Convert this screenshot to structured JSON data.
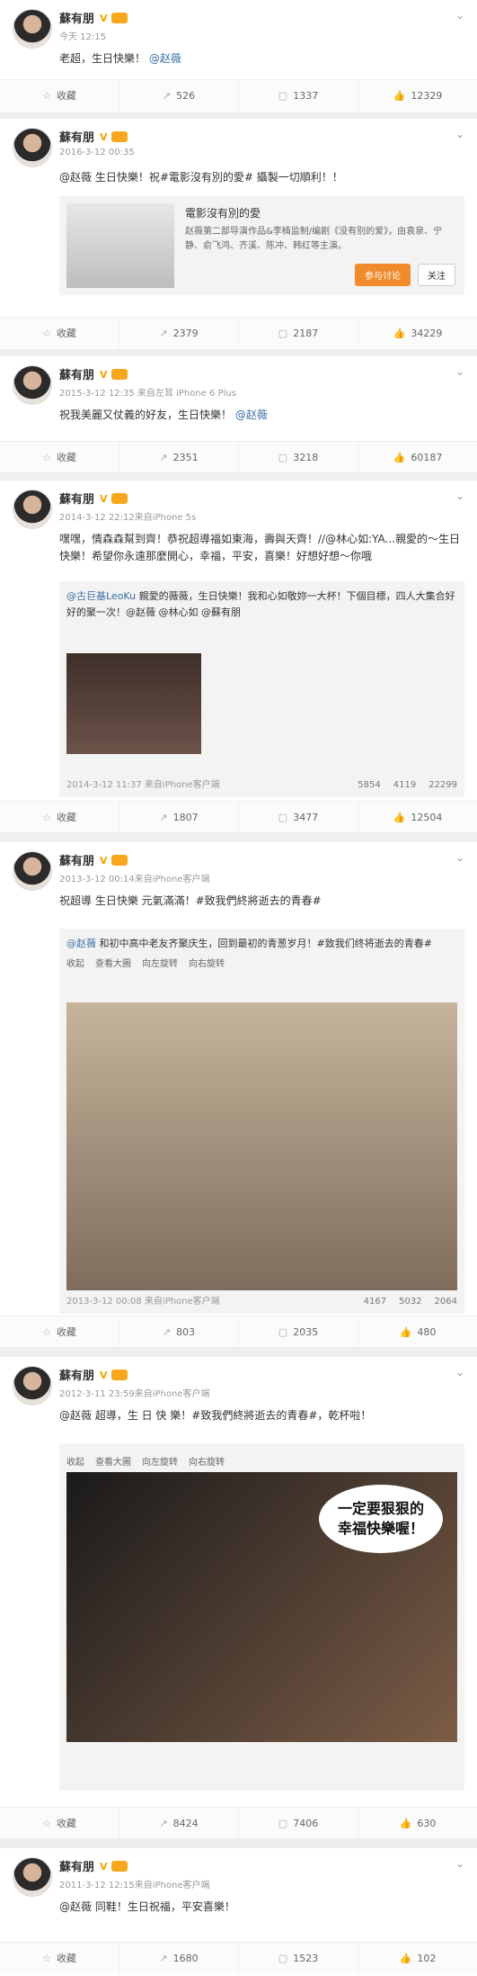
{
  "user": "蘇有朋",
  "posts": [
    {
      "time": "今天 12:15",
      "text": "老超，生日快樂！",
      "mention": "@赵薇",
      "actions": {
        "collect": "收藏",
        "forward": "526",
        "comment": "1337",
        "like": "12329"
      }
    },
    {
      "time": "2016-3-12 00:35",
      "text": "@赵薇 生日快樂！祝#電影沒有別的愛# 攝製一切順利！！",
      "card": {
        "title": "電影沒有別的愛",
        "desc": "赵薇第二部导演作品&李楠监制/编剧《没有别的爱》，由袁泉、宁静、俞飞鸿、齐溪、陈冲、韩红等主演。",
        "btn1": "参与讨论",
        "btn2": "关注"
      },
      "actions": {
        "collect": "收藏",
        "forward": "2379",
        "comment": "2187",
        "like": "34229"
      }
    },
    {
      "time": "2015-3-12 12:35 来自左耳 iPhone 6 Plus",
      "text": "祝我美麗又仗義的好友，生日快樂！",
      "mention": "@赵薇",
      "actions": {
        "collect": "收藏",
        "forward": "2351",
        "comment": "3218",
        "like": "60187"
      }
    },
    {
      "time": "2014-3-12 22:12来自iPhone 5s",
      "text": "嘿嘿，情森森幫到齊！恭祝超導福如東海，壽與天齊！//@林心如:YA...親愛的～生日快樂！希望你永遠那麼開心，幸福，平安，喜樂！好想好想～你哦",
      "repost": {
        "author": "@古巨基LeoKu",
        "text": "親愛的薇薇，生日快樂！我和心如敬妳一大杯！下個目標，四人大集合好好的聚一次！@赵薇 @林心如 @蘇有朋",
        "meta": "2014-3-12 11:37 来自iPhone客户端",
        "stats": {
          "forward": "5854",
          "comment": "4119",
          "like": "22299"
        }
      },
      "actions": {
        "collect": "收藏",
        "forward": "1807",
        "comment": "3477",
        "like": "12504"
      }
    },
    {
      "time": "2013-3-12 00:14来自iPhone客户端",
      "text": "祝超導 生日快樂 元氣滿滿！#致我們終將逝去的青春#",
      "repost": {
        "author": "@赵薇",
        "text": "和初中高中老友齐聚庆生，回到最初的青葱岁月！#致我们终将逝去的青春#",
        "meta": "2013-3-12 00:08 来自iPhone客户端",
        "stats": {
          "forward": "4167",
          "comment": "5032",
          "like": "2064"
        },
        "tools": [
          "收起",
          "查看大圖",
          "向左旋转",
          "向右旋转"
        ]
      },
      "actions": {
        "collect": "收藏",
        "forward": "803",
        "comment": "2035",
        "like": "480"
      }
    },
    {
      "time": "2012-3-11 23:59来自iPhone客户端",
      "text": "@赵薇 超導，生 日 快 樂！#致我們終將逝去的青春#，乾杯啦！",
      "repost": {
        "tools": [
          "收起",
          "查看大圖",
          "向左旋转",
          "向右旋转"
        ],
        "caption": "一定要狠狠的幸福快樂喔！"
      },
      "actions": {
        "collect": "收藏",
        "forward": "8424",
        "comment": "7406",
        "like": "630"
      }
    },
    {
      "time": "2011-3-12 12:15来自iPhone客户端",
      "text": "@赵薇 同鞋！生日祝福，平安喜樂！",
      "actions": {
        "collect": "收藏",
        "forward": "1680",
        "comment": "1523",
        "like": "102"
      }
    }
  ]
}
